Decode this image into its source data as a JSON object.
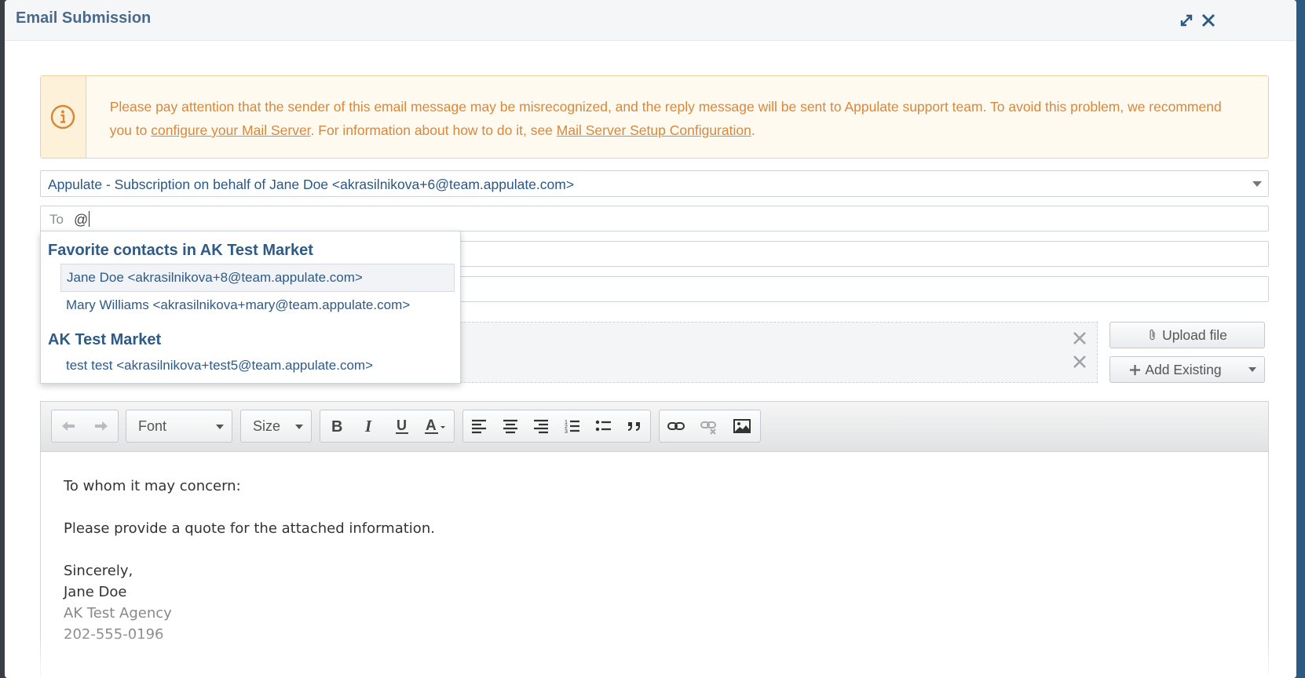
{
  "modal": {
    "title": "Email Submission"
  },
  "alert": {
    "text_1": "Please pay attention that the sender of this email message may be misrecognized, and the reply message will be sent to Appulate support team. To avoid this problem, we recommend you to ",
    "link_1": "configure your Mail Server",
    "text_2": ". For information about how to do it, see ",
    "link_2": "Mail Server Setup Configuration",
    "text_3": "."
  },
  "from": {
    "value": "Appulate - Subscription on behalf of Jane Doe <akrasilnikova+6@team.appulate.com>"
  },
  "to": {
    "label": "To",
    "value": "@"
  },
  "autocomplete": {
    "groups": [
      {
        "title": "Favorite contacts in AK Test Market",
        "items": [
          "Jane Doe <akrasilnikova+8@team.appulate.com>",
          "Mary Williams <akrasilnikova+mary@team.appulate.com>"
        ]
      },
      {
        "title": "AK Test Market",
        "items": [
          "test test <akrasilnikova+test5@team.appulate.com>"
        ]
      }
    ]
  },
  "attachments": {
    "upload_label": "Upload file",
    "add_existing_label": "Add Existing"
  },
  "toolbar": {
    "font_label": "Font",
    "size_label": "Size",
    "icons": [
      "undo-icon",
      "redo-icon",
      "bold-icon",
      "italic-icon",
      "underline-icon",
      "font-color-icon",
      "align-left-icon",
      "align-center-icon",
      "align-right-icon",
      "numbered-list-icon",
      "bullet-list-icon",
      "blockquote-icon",
      "link-icon",
      "unlink-icon",
      "image-icon"
    ]
  },
  "body": {
    "line_1": "To whom it may concern:",
    "line_2": "Please provide a quote for the attached information.",
    "line_3": "Sincerely,",
    "line_4": "Jane Doe",
    "line_5": "AK Test Agency",
    "line_6": "202-555-0196"
  },
  "colors": {
    "accent": "#2e5a87",
    "warning_text": "#d9873a",
    "warning_bg": "#fffaf0"
  }
}
